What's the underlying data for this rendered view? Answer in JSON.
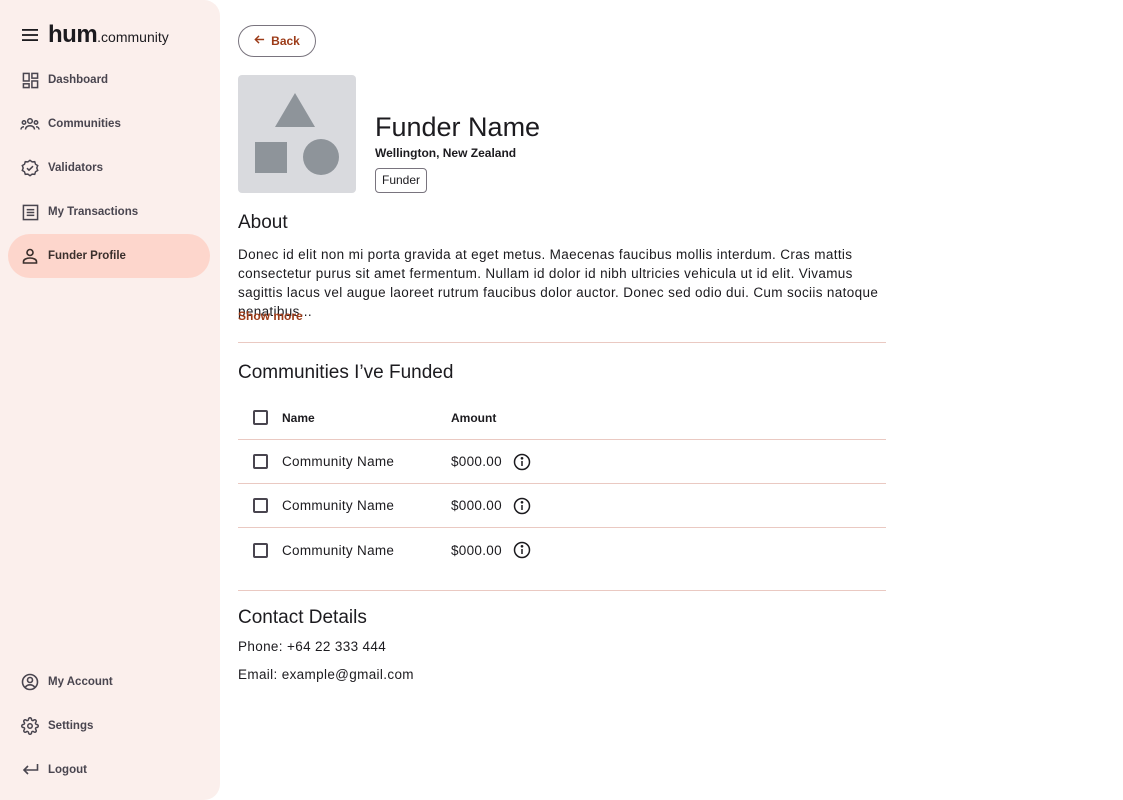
{
  "brand": {
    "name_bold": "hum",
    "name_suffix": ".community",
    "menu_icon": "menu-icon"
  },
  "sidebar": {
    "items": [
      {
        "label": "Dashboard",
        "icon": "dashboard-icon"
      },
      {
        "label": "Communities",
        "icon": "groups-icon"
      },
      {
        "label": "Validators",
        "icon": "verified-badge-icon"
      },
      {
        "label": "My Transactions",
        "icon": "receipt-list-icon"
      },
      {
        "label": "Funder Profile",
        "icon": "person-icon",
        "active": true
      }
    ],
    "bottom_items": [
      {
        "label": "My Account",
        "icon": "account-circle-icon"
      },
      {
        "label": "Settings",
        "icon": "settings-gear-icon"
      },
      {
        "label": "Logout",
        "icon": "logout-arrow-icon"
      }
    ]
  },
  "back_button": {
    "label": "Back",
    "icon": "arrow-left-icon"
  },
  "profile": {
    "name": "Funder Name",
    "location": "Wellington, New Zealand",
    "role_chip": "Funder",
    "avatar_icon": "shapes-placeholder-icon"
  },
  "about": {
    "title": "About",
    "text": "Donec id elit non mi porta gravida at eget metus. Maecenas faucibus mollis interdum. Cras mattis consectetur purus sit amet fermentum. Nullam id dolor id nibh ultricies vehicula ut id elit.  Vivamus sagittis lacus vel augue laoreet rutrum faucibus dolor auctor. Donec sed odio dui. Cum sociis natoque penatibus...",
    "show_more": "Show more"
  },
  "funded": {
    "title": "Communities I’ve Funded",
    "columns": {
      "name": "Name",
      "amount": "Amount"
    },
    "rows": [
      {
        "name": "Community Name",
        "amount": "$000.00",
        "icon": "info-icon"
      },
      {
        "name": "Community Name",
        "amount": "$000.00",
        "icon": "info-icon"
      },
      {
        "name": "Community Name",
        "amount": "$000.00",
        "icon": "info-icon"
      }
    ]
  },
  "contact": {
    "title": "Contact Details",
    "phone": "Phone: +64 22 333 444",
    "email": "Email: example@gmail.com"
  },
  "colors": {
    "sidebar_bg": "#fbefec",
    "active_nav_bg": "#fdd6cc",
    "accent": "#9c3b18",
    "divider": "#eac9c2",
    "avatar_bg": "#d9dade",
    "avatar_shape": "#8e949a"
  }
}
